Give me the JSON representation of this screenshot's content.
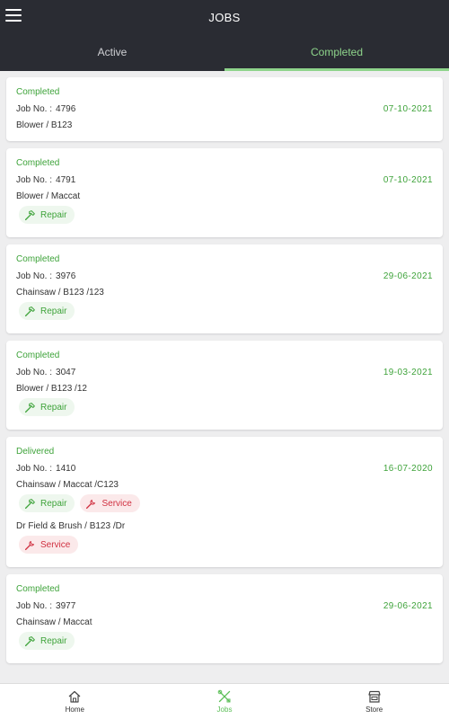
{
  "header": {
    "title": "JOBS"
  },
  "tabs": [
    {
      "label": "Active"
    },
    {
      "label": "Completed"
    }
  ],
  "active_tab": "Completed",
  "job_no_label": "Job No. :",
  "jobs": [
    {
      "status": "Completed",
      "job_no": "4796",
      "date": "07-10-2021",
      "products": [
        {
          "name": "Blower / B123",
          "tags": []
        }
      ]
    },
    {
      "status": "Completed",
      "job_no": "4791",
      "date": "07-10-2021",
      "products": [
        {
          "name": "Blower / Maccat",
          "tags": [
            "Repair"
          ]
        }
      ]
    },
    {
      "status": "Completed",
      "job_no": "3976",
      "date": "29-06-2021",
      "products": [
        {
          "name": "Chainsaw / B123 /123",
          "tags": [
            "Repair"
          ]
        }
      ]
    },
    {
      "status": "Completed",
      "job_no": "3047",
      "date": "19-03-2021",
      "products": [
        {
          "name": "Blower / B123 /12",
          "tags": [
            "Repair"
          ]
        }
      ]
    },
    {
      "status": "Delivered",
      "job_no": "1410",
      "date": "16-07-2020",
      "products": [
        {
          "name": "Chainsaw / Maccat /C123",
          "tags": [
            "Repair",
            "Service"
          ]
        },
        {
          "name": "Dr Field & Brush / B123 /Dr",
          "tags": [
            "Service"
          ]
        }
      ]
    },
    {
      "status": "Completed",
      "job_no": "3977",
      "date": "29-06-2021",
      "products": [
        {
          "name": "Chainsaw / Maccat",
          "tags": [
            "Repair"
          ]
        }
      ]
    }
  ],
  "bottom_nav": [
    {
      "label": "Home",
      "icon": "home-icon"
    },
    {
      "label": "Jobs",
      "icon": "tools-icon"
    },
    {
      "label": "Store",
      "icon": "store-icon"
    }
  ],
  "colors": {
    "appbar": "#2a2c33",
    "accent_green": "#3ea33a",
    "tab_active": "#8ed48b",
    "service_red": "#d03040",
    "background": "#eeeeef"
  }
}
